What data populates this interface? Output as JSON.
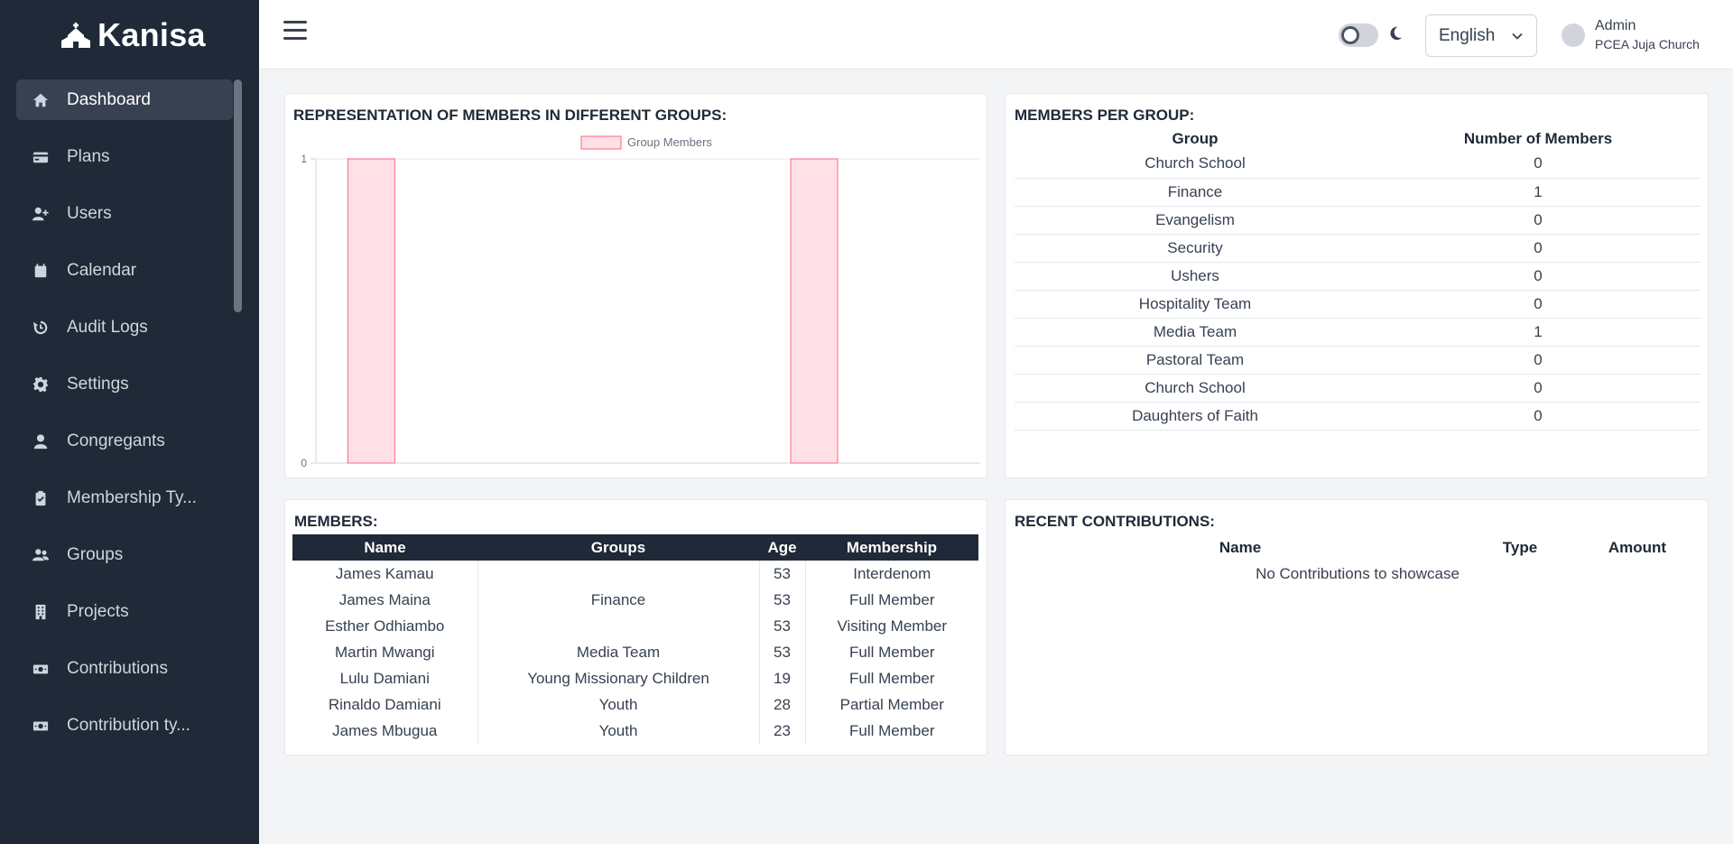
{
  "app": {
    "name": "Kanisa"
  },
  "sidebar": {
    "items": [
      {
        "label": "Dashboard",
        "icon": "home-icon",
        "active": true
      },
      {
        "label": "Plans",
        "icon": "credit-card-icon"
      },
      {
        "label": "Users",
        "icon": "user-plus-icon"
      },
      {
        "label": "Calendar",
        "icon": "calendar-icon"
      },
      {
        "label": "Audit Logs",
        "icon": "history-icon"
      },
      {
        "label": "Settings",
        "icon": "gear-icon"
      },
      {
        "label": "Congregants",
        "icon": "user-icon"
      },
      {
        "label": "Membership Ty...",
        "icon": "clipboard-check-icon"
      },
      {
        "label": "Groups",
        "icon": "users-icon"
      },
      {
        "label": "Projects",
        "icon": "building-icon"
      },
      {
        "label": "Contributions",
        "icon": "money-icon"
      },
      {
        "label": "Contribution ty...",
        "icon": "money-icon"
      }
    ]
  },
  "header": {
    "language": "English",
    "user_name": "Admin",
    "user_church": "PCEA Juja Church"
  },
  "chart_card": {
    "title": "REPRESENTATION OF MEMBERS IN DIFFERENT GROUPS:"
  },
  "chart_data": {
    "type": "bar",
    "series": [
      {
        "name": "Group Members",
        "values": [
          1,
          0,
          0,
          0,
          1,
          0
        ]
      }
    ],
    "categories": [
      "",
      "",
      "",
      "",
      "",
      ""
    ],
    "y_ticks": [
      "0",
      "1"
    ],
    "ylim": [
      0,
      1
    ],
    "colors": {
      "bar_fill": "#ffe0e6",
      "bar_stroke": "#ff6384"
    },
    "legend_position": "top-center",
    "grid": true
  },
  "members_per_group": {
    "title": "MEMBERS PER GROUP:",
    "columns": [
      "Group",
      "Number of Members"
    ],
    "rows": [
      [
        "Church School",
        "0"
      ],
      [
        "Finance",
        "1"
      ],
      [
        "Evangelism",
        "0"
      ],
      [
        "Security",
        "0"
      ],
      [
        "Ushers",
        "0"
      ],
      [
        "Hospitality Team",
        "0"
      ],
      [
        "Media Team",
        "1"
      ],
      [
        "Pastoral Team",
        "0"
      ],
      [
        "Church School",
        "0"
      ],
      [
        "Daughters of Faith",
        "0"
      ]
    ]
  },
  "members": {
    "title": "MEMBERS:",
    "columns": [
      "Name",
      "Groups",
      "Age",
      "Membership"
    ],
    "rows": [
      [
        "James Kamau",
        "",
        "53",
        "Interdenom"
      ],
      [
        "James Maina",
        "Finance",
        "53",
        "Full Member"
      ],
      [
        "Esther Odhiambo",
        "",
        "53",
        "Visiting Member"
      ],
      [
        "Martin Mwangi",
        "Media Team",
        "53",
        "Full Member"
      ],
      [
        "Lulu Damiani",
        "Young Missionary Children",
        "19",
        "Full Member"
      ],
      [
        "Rinaldo Damiani",
        "Youth",
        "28",
        "Partial Member"
      ],
      [
        "James Mbugua",
        "Youth",
        "23",
        "Full Member"
      ]
    ]
  },
  "contributions": {
    "title": "RECENT CONTRIBUTIONS:",
    "columns": [
      "Name",
      "Type",
      "Amount"
    ],
    "empty": "No Contributions to showcase"
  }
}
